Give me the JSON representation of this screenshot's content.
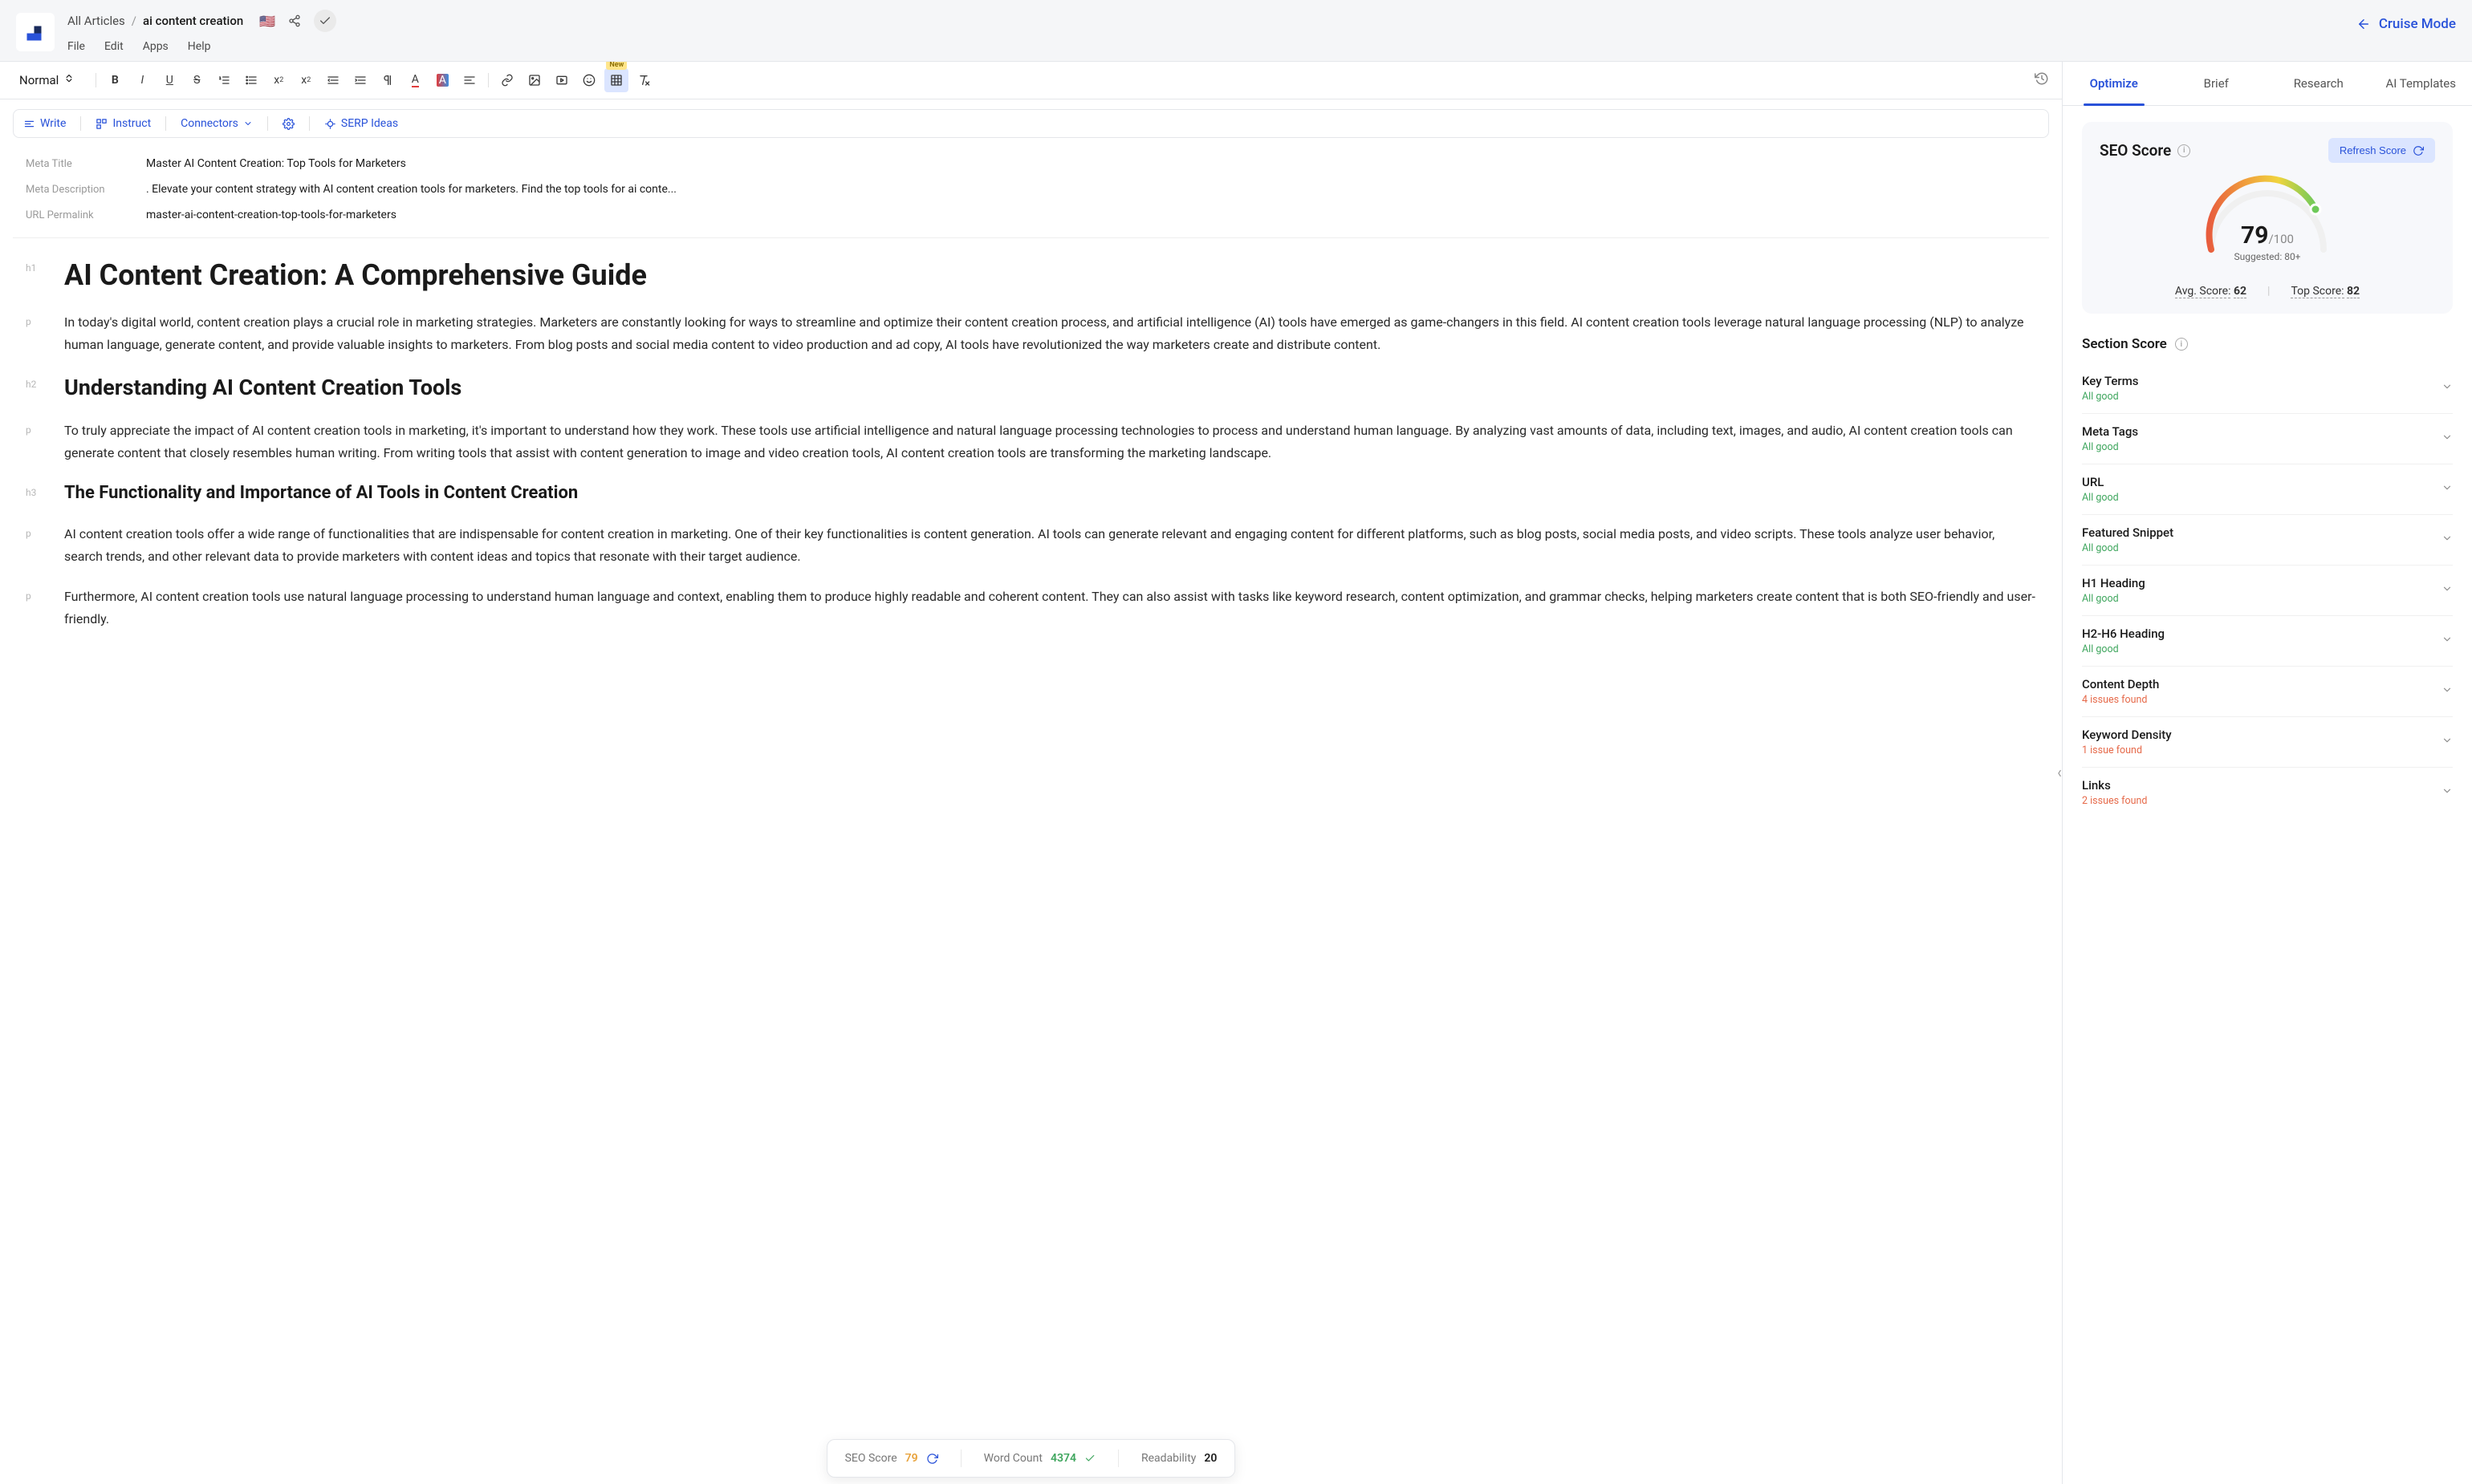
{
  "breadcrumb": {
    "root": "All Articles",
    "current": "ai content creation"
  },
  "menubar": [
    "File",
    "Edit",
    "Apps",
    "Help"
  ],
  "cruise_label": "Cruise Mode",
  "toolbar": {
    "format_select": "Normal",
    "new_badge": "New"
  },
  "aibar": {
    "write": "Write",
    "instruct": "Instruct",
    "connectors": "Connectors",
    "serp": "SERP Ideas"
  },
  "meta": {
    "title_label": "Meta Title",
    "title_value": "Master AI Content Creation: Top Tools for Marketers",
    "desc_label": "Meta Description",
    "desc_value": ". Elevate your content strategy with AI content creation tools for marketers. Find the top tools for ai conte...",
    "url_label": "URL Permalink",
    "url_value": "master-ai-content-creation-top-tools-for-marketers"
  },
  "doc": {
    "h1": "AI Content Creation: A Comprehensive Guide",
    "p1": "In today's digital world, content creation plays a crucial role in marketing strategies. Marketers are constantly looking for ways to streamline and optimize their content creation process, and artificial intelligence (AI) tools have emerged as game-changers in this field. AI content creation tools leverage natural language processing (NLP) to analyze human language, generate content, and provide valuable insights to marketers. From blog posts and social media content to video production and ad copy, AI tools have revolutionized the way marketers create and distribute content.",
    "h2": "Understanding AI Content Creation Tools",
    "p2": "To truly appreciate the impact of AI content creation tools in marketing, it's important to understand how they work. These tools use artificial intelligence and natural language processing technologies to process and understand human language. By analyzing vast amounts of data, including text, images, and audio, AI content creation tools can generate content that closely resembles human writing. From writing tools that assist with content generation to image and video creation tools, AI content creation tools are transforming the marketing landscape.",
    "h3": "The Functionality and Importance of AI Tools in Content Creation",
    "p3": "AI content creation tools offer a wide range of functionalities that are indispensable for content creation in marketing. One of their key functionalities is content generation. AI tools can generate relevant and engaging content for different platforms, such as blog posts, social media posts, and video scripts. These tools analyze user behavior, search trends, and other relevant data to provide marketers with content ideas and topics that resonate with their target audience.",
    "p4": " Furthermore, AI content creation tools use natural language processing to understand human language and context, enabling them to produce highly readable and coherent content. They can also assist with tasks like keyword research, content optimization, and grammar checks, helping marketers create content that is both SEO-friendly and user-friendly."
  },
  "gutters": {
    "h1": "h1",
    "h2": "h2",
    "h3": "h3",
    "p": "p"
  },
  "statusbar": {
    "seo_label": "SEO Score",
    "seo_value": "79",
    "wc_label": "Word Count",
    "wc_value": "4374",
    "read_label": "Readability",
    "read_value": "20"
  },
  "side": {
    "tabs": [
      "Optimize",
      "Brief",
      "Research",
      "AI Templates"
    ],
    "seo_title": "SEO Score",
    "refresh": "Refresh Score",
    "score": "79",
    "score_max": "/100",
    "suggested": "Suggested: 80+",
    "avg_label": "Avg. Score:",
    "avg_val": "62",
    "top_label": "Top Score:",
    "top_val": "82",
    "section_title": "Section Score",
    "sections": [
      {
        "name": "Key Terms",
        "status": "All good",
        "ok": true
      },
      {
        "name": "Meta Tags",
        "status": "All good",
        "ok": true
      },
      {
        "name": "URL",
        "status": "All good",
        "ok": true
      },
      {
        "name": "Featured Snippet",
        "status": "All good",
        "ok": true
      },
      {
        "name": "H1 Heading",
        "status": "All good",
        "ok": true
      },
      {
        "name": "H2-H6 Heading",
        "status": "All good",
        "ok": true
      },
      {
        "name": "Content Depth",
        "status": "4 issues found",
        "ok": false
      },
      {
        "name": "Keyword Density",
        "status": "1 issue found",
        "ok": false
      },
      {
        "name": "Links",
        "status": "2 issues found",
        "ok": false
      }
    ]
  }
}
